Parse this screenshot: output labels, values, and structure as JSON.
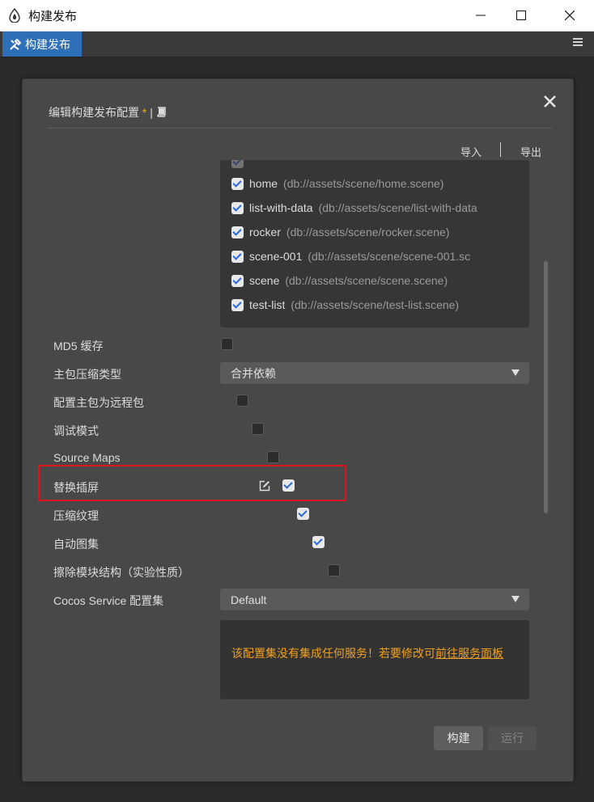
{
  "window": {
    "title": "构建发布"
  },
  "tab": {
    "label": "构建发布"
  },
  "dialog": {
    "title": "编辑构建发布配置",
    "dirty_marker": "*",
    "title_separator": "|",
    "import_label": "导入",
    "export_label": "导出"
  },
  "scenes": [
    {
      "name": "home",
      "path": "(db://assets/scene/home.scene)",
      "checked": true
    },
    {
      "name": "list-with-data",
      "path": "(db://assets/scene/list-with-data",
      "checked": true
    },
    {
      "name": "rocker",
      "path": "(db://assets/scene/rocker.scene)",
      "checked": true
    },
    {
      "name": "scene-001",
      "path": "(db://assets/scene/scene-001.sc",
      "checked": true
    },
    {
      "name": "scene",
      "path": "(db://assets/scene/scene.scene)",
      "checked": true
    },
    {
      "name": "test-list",
      "path": "(db://assets/scene/test-list.scene)",
      "checked": true
    }
  ],
  "options": {
    "md5_cache": {
      "label": "MD5 缓存",
      "checked": false
    },
    "main_bundle_compression": {
      "label": "主包压缩类型",
      "value": "合并依赖"
    },
    "main_bundle_remote": {
      "label": "配置主包为远程包",
      "checked": false
    },
    "debug_mode": {
      "label": "调试模式",
      "checked": false
    },
    "source_maps": {
      "label": "Source Maps",
      "checked": false
    },
    "replace_splash": {
      "label": "替换插屏",
      "checked": true
    },
    "compress_texture": {
      "label": "压缩纹理",
      "checked": true
    },
    "auto_atlas": {
      "label": "自动图集",
      "checked": true
    },
    "erase_module_structure": {
      "label": "擦除模块结构（实验性质）",
      "checked": false
    },
    "cocos_service": {
      "label": "Cocos Service 配置集",
      "value": "Default"
    }
  },
  "notice": {
    "text": "该配置集没有集成任何服务！若要修改可",
    "link_text": "前往服务面板"
  },
  "buttons": {
    "build": "构建",
    "run": "运行"
  },
  "colors": {
    "accent": "#2f6fb8",
    "warning": "#f0a020",
    "highlight": "#e0141e"
  }
}
